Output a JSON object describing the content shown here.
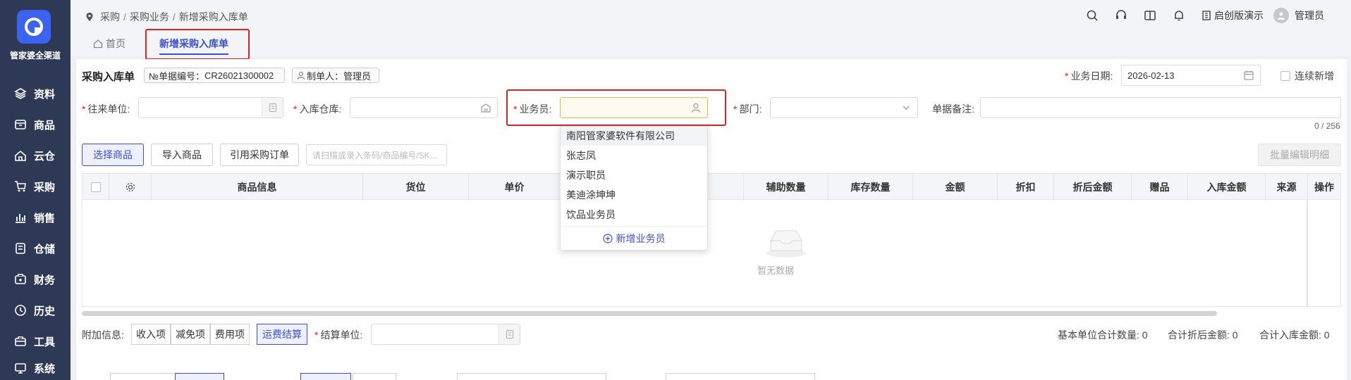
{
  "sidebar": {
    "brand": "管家婆全渠道",
    "items": [
      {
        "label": "资料",
        "icon": "layers-icon"
      },
      {
        "label": "商品",
        "icon": "box-icon"
      },
      {
        "label": "云仓",
        "icon": "cloud-house-icon"
      },
      {
        "label": "采购",
        "icon": "cart-icon"
      },
      {
        "label": "销售",
        "icon": "bar-chart-icon"
      },
      {
        "label": "仓储",
        "icon": "storage-icon"
      },
      {
        "label": "财务",
        "icon": "wallet-icon"
      },
      {
        "label": "历史",
        "icon": "clock-icon"
      },
      {
        "label": "工具",
        "icon": "toolbox-icon"
      },
      {
        "label": "系统",
        "icon": "monitor-icon"
      }
    ]
  },
  "breadcrumb": {
    "items": [
      "采购",
      "采购业务",
      "新增采购入库单"
    ]
  },
  "topbar": {
    "edition": "启创版演示",
    "user": "管理员"
  },
  "tabs": {
    "home": "首页",
    "active": "新增采购入库单"
  },
  "form": {
    "title": "采购入库单",
    "doc_no_label": "№单据编号：",
    "doc_no": "CR26021300002",
    "creator_label": "制单人：",
    "creator": "管理员",
    "biz_date_label": "业务日期:",
    "biz_date": "2026-02-13",
    "continuous_add": "连续新增",
    "supplier_label": "往来单位:",
    "warehouse_label": "入库仓库:",
    "salesman_label": "业务员:",
    "department_label": "部门:",
    "remark_label": "单据备注:",
    "remark_counter": "0 / 256"
  },
  "toolbar": {
    "select_goods": "选择商品",
    "import_goods": "导入商品",
    "ref_order": "引用采购订单",
    "scan_placeholder": "请扫描或录入条码/商品编号/SK...",
    "batch_edit": "批量编辑明细"
  },
  "table": {
    "columns": [
      "商品信息",
      "货位",
      "单价",
      "辅助数量",
      "库存数量",
      "金额",
      "折扣",
      "折后金额",
      "赠品",
      "入库金额",
      "来源",
      "操作"
    ],
    "empty_text": "暂无数据"
  },
  "dropdown": {
    "options": [
      "南阳管家婆软件有限公司",
      "张志凤",
      "演示职员",
      "美迪涂坤坤",
      "饮品业务员"
    ],
    "add_label": "新增业务员"
  },
  "footer": {
    "extra_label": "附加信息:",
    "segments": [
      "收入项",
      "减免项",
      "费用项",
      "运费结算"
    ],
    "settle_label": "结算单位:",
    "total_qty_label": "基本单位合计数量:",
    "total_qty": "0",
    "total_discounted_label": "合计折后金额:",
    "total_discounted": "0",
    "total_in_label": "合计入库金额:",
    "total_in": "0"
  },
  "colors": {
    "sidebar": "#2e3a55",
    "accent": "#3c4fd8",
    "highlight": "#e02020"
  }
}
